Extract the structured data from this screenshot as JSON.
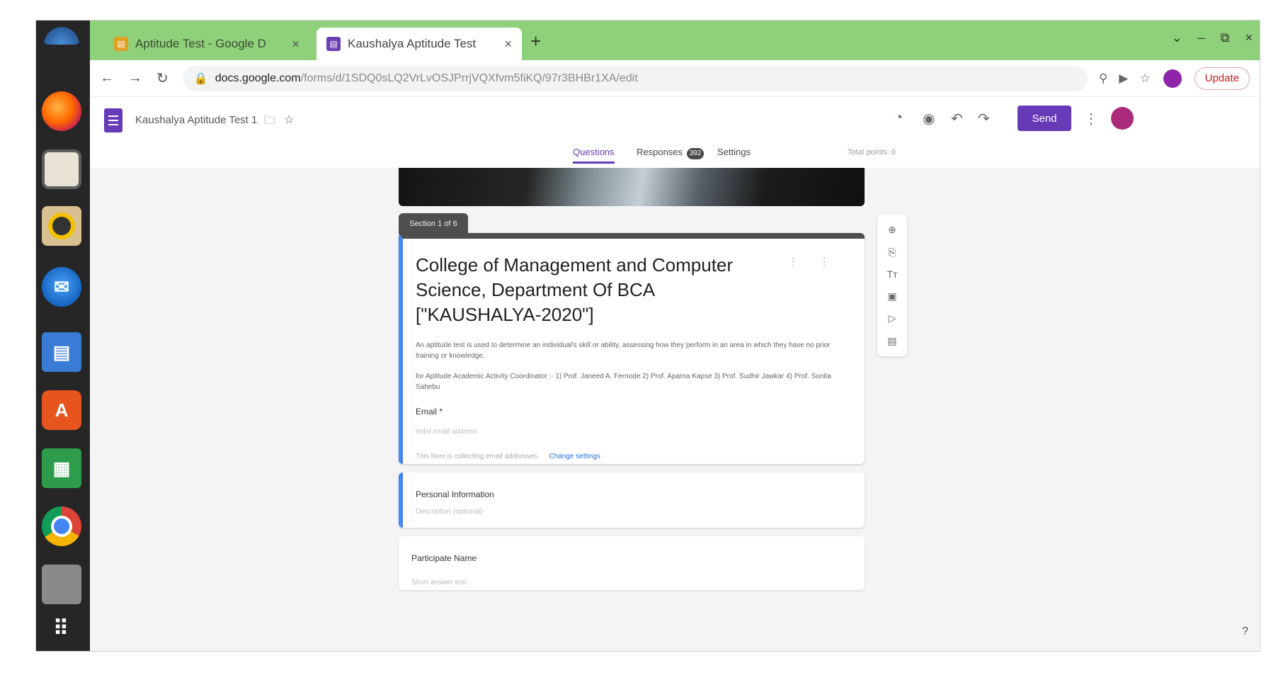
{
  "browser": {
    "tabs": [
      {
        "label": "Aptitude Test - Google D",
        "close": "×"
      },
      {
        "label": "Kaushalya Aptitude Test",
        "close": "×"
      }
    ],
    "new_tab": "+",
    "window_controls": [
      "⌄",
      "–",
      "⧉",
      "×"
    ],
    "address": {
      "host": "docs.google.com",
      "path": "/forms/d/1SDQ0sLQ2VrLvOSJPrrjVQXfvm5fiKQ/97r3BHBr1XA/edit"
    },
    "update_label": "Update"
  },
  "form_header": {
    "doc_title": "Kaushalya Aptitude Test 1",
    "send_label": "Send"
  },
  "form_tabs": {
    "questions": "Questions",
    "responses": "Responses",
    "responses_count": "392",
    "settings": "Settings",
    "total_points": "Total points: 0"
  },
  "section_tag": "Section 1 of 6",
  "title_card": {
    "title": "College of Management and Computer Science, Department Of BCA [\"KAUSHALYA-2020\"]",
    "description_1": "An aptitude test is used to determine an individual's skill or ability, assessing how they perform in an area in which they have no prior training or knowledge.",
    "description_2": "for Aptitude Academic Activity Coordinator :- 1) Prof. Janeed A. Fernode 2) Prof. Aparna Kapse 3) Prof. Sudhir Jawkar 4) Prof. Sunita Sahebu",
    "email_label": "Email *",
    "email_placeholder": "Valid email address",
    "email_note": "This form is collecting email addresses.",
    "email_note_link": "Change settings"
  },
  "section2": {
    "title": "Personal Information",
    "placeholder": "Description (optional)"
  },
  "question": {
    "label": "Participate Name",
    "placeholder": "Short answer text"
  },
  "icons": {
    "dock": [
      "show-desktop-icon",
      "firefox-icon",
      "files-icon",
      "rhythmbox-icon",
      "thunderbird-icon",
      "writer-icon",
      "software-icon",
      "calc-icon",
      "chrome-icon",
      "trash-icon",
      "app-grid-icon"
    ],
    "toolbar": [
      "back-icon",
      "forward-icon",
      "reload-icon",
      "lock-icon",
      "zoom-icon",
      "cast-icon",
      "star-icon"
    ],
    "rail": [
      "add-question-icon",
      "import-icon",
      "title-icon",
      "image-icon",
      "video-icon",
      "section-icon"
    ]
  }
}
